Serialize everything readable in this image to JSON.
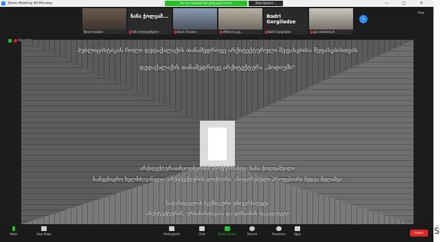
{
  "window": {
    "title": "Zoom Meeting 40-Minutes",
    "share_banner": "You are viewing ნანა ჭოლკავის screen",
    "view_options": "View Options ⌄",
    "minimize": "—",
    "maximize": "□",
    "close": "✕"
  },
  "participants": [
    {
      "name": "Nino Irmaidze",
      "big_name": ""
    },
    {
      "name": "ნანა ჭოლეჯეიშვილი",
      "big_name": "ნანა ჭოლეაშ..."
    },
    {
      "name": "Nana Fresidze",
      "big_name": ""
    },
    {
      "name": "არჩილის გეგ...",
      "big_name": ""
    },
    {
      "name": "Badri Gorgiladze",
      "big_name": "Badri Gorgiladze"
    },
    {
      "name": "gia natsvlishvili",
      "big_name": ""
    }
  ],
  "view_button": "View",
  "status": {
    "recording": "Recording"
  },
  "slide": {
    "line1": "პუბლიცისტიკის როლი დედაქალაქის თანამედროვე არქიტექტურული შეფასებისა შეფასებისთვის",
    "line2": "დედაქალაქის თანამედროვე არქიტექტურა „პოდიუმი\"",
    "line3": "არქიტექტურათმცოდნეობის დოქტორანტი: ნანა ჭოლეაშვილი",
    "line4": "სამეცნიერო ხელმძღვანელი: არქიტექტურის დოქტორი, ასოცირებული პროფესორი მედეა მელაშვი",
    "line5": "საქართველოს ტექნიკური უნივერსიტეტი",
    "line6": "არქიტექტურის, ურბანისტიკისა და დიზაინის ფაკულტეტი"
  },
  "toolbar": {
    "mute": "Mute",
    "stop_video": "Stop Video",
    "participants": "Participants",
    "participants_count": "10",
    "chat": "Chat",
    "share_screen": "Share Screen",
    "record": "Record",
    "reactions": "Reactions",
    "apps": "Apps",
    "leave": "Leave"
  },
  "side_glyph": "Ṡ",
  "colors": {
    "accent": "#2d8cff",
    "share": "#26c126",
    "leave": "#e02828"
  }
}
